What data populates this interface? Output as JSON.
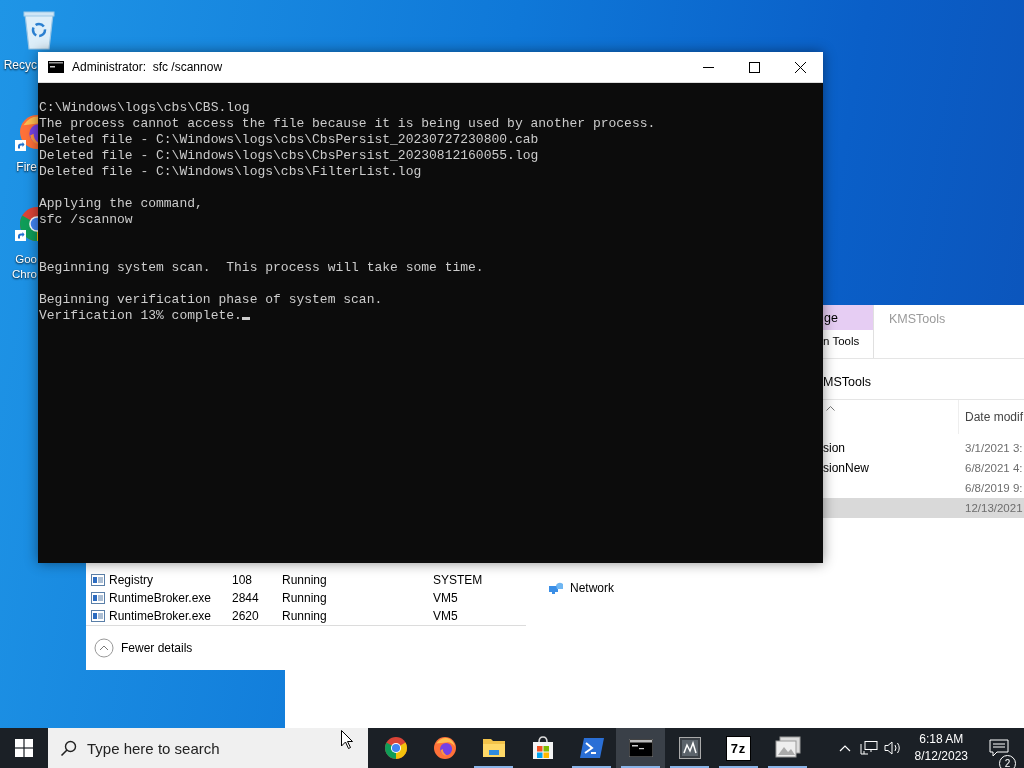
{
  "desktop_icons": [
    {
      "kind": "recycle-bin",
      "label": "Recyc"
    },
    {
      "kind": "firefox",
      "label": "Fire"
    },
    {
      "kind": "chrome",
      "label": "Goo Chro"
    }
  ],
  "console": {
    "title": "Administrator:  sfc /scannow",
    "output": "C:\\Windows\\logs\\cbs\\CBS.log\nThe process cannot access the file because it is being used by another process.\nDeleted file - C:\\Windows\\logs\\cbs\\CbsPersist_20230727230800.cab\nDeleted file - C:\\Windows\\logs\\cbs\\CbsPersist_20230812160055.log\nDeleted file - C:\\Windows\\logs\\cbs\\FilterList.log\n\nApplying the command,\nsfc /scannow\n\n\nBeginning system scan.  This process will take some time.\n\nBeginning verification phase of system scan.\nVerification 13% complete.",
    "cursor_visible": true
  },
  "explorer": {
    "context_tab": {
      "label": "ge",
      "selected": true
    },
    "context_group": "n Tools",
    "title": "KMSTools",
    "address": "MSTools",
    "columns": [
      {
        "label": "Date modif"
      }
    ],
    "rows": [
      {
        "name": "sion",
        "date": "3/1/2021 3:",
        "selected": false
      },
      {
        "name": "sionNew",
        "date": "6/8/2021 4:",
        "selected": false
      },
      {
        "date": "6/8/2019 9:",
        "selected": false
      },
      {
        "date": "12/13/2021",
        "selected": true
      }
    ],
    "nav": [
      {
        "label": "Network"
      }
    ]
  },
  "task_manager": {
    "processes": [
      {
        "name": "Registry",
        "pid": "108",
        "status": "Running",
        "user": "SYSTEM"
      },
      {
        "name": "RuntimeBroker.exe",
        "pid": "2844",
        "status": "Running",
        "user": "VM5"
      },
      {
        "name": "RuntimeBroker.exe",
        "pid": "2620",
        "status": "Running",
        "user": "VM5"
      }
    ],
    "footer": "Fewer details"
  },
  "taskbar": {
    "search_placeholder": "Type here to search",
    "apps": [
      {
        "kind": "chrome",
        "running": false,
        "active": false
      },
      {
        "kind": "firefox",
        "running": false,
        "active": false
      },
      {
        "kind": "folder",
        "running": true,
        "active": false
      },
      {
        "kind": "store",
        "running": false,
        "active": false
      },
      {
        "kind": "powershell",
        "running": true,
        "active": false
      },
      {
        "kind": "console",
        "running": true,
        "active": true
      },
      {
        "kind": "monitor",
        "running": true,
        "active": false
      },
      {
        "kind": "archive",
        "label": "7z",
        "running": true,
        "active": false
      },
      {
        "kind": "photos",
        "running": true,
        "active": false
      }
    ],
    "time": "6:18 AM",
    "date": "8/12/2023",
    "notifications": "2"
  }
}
